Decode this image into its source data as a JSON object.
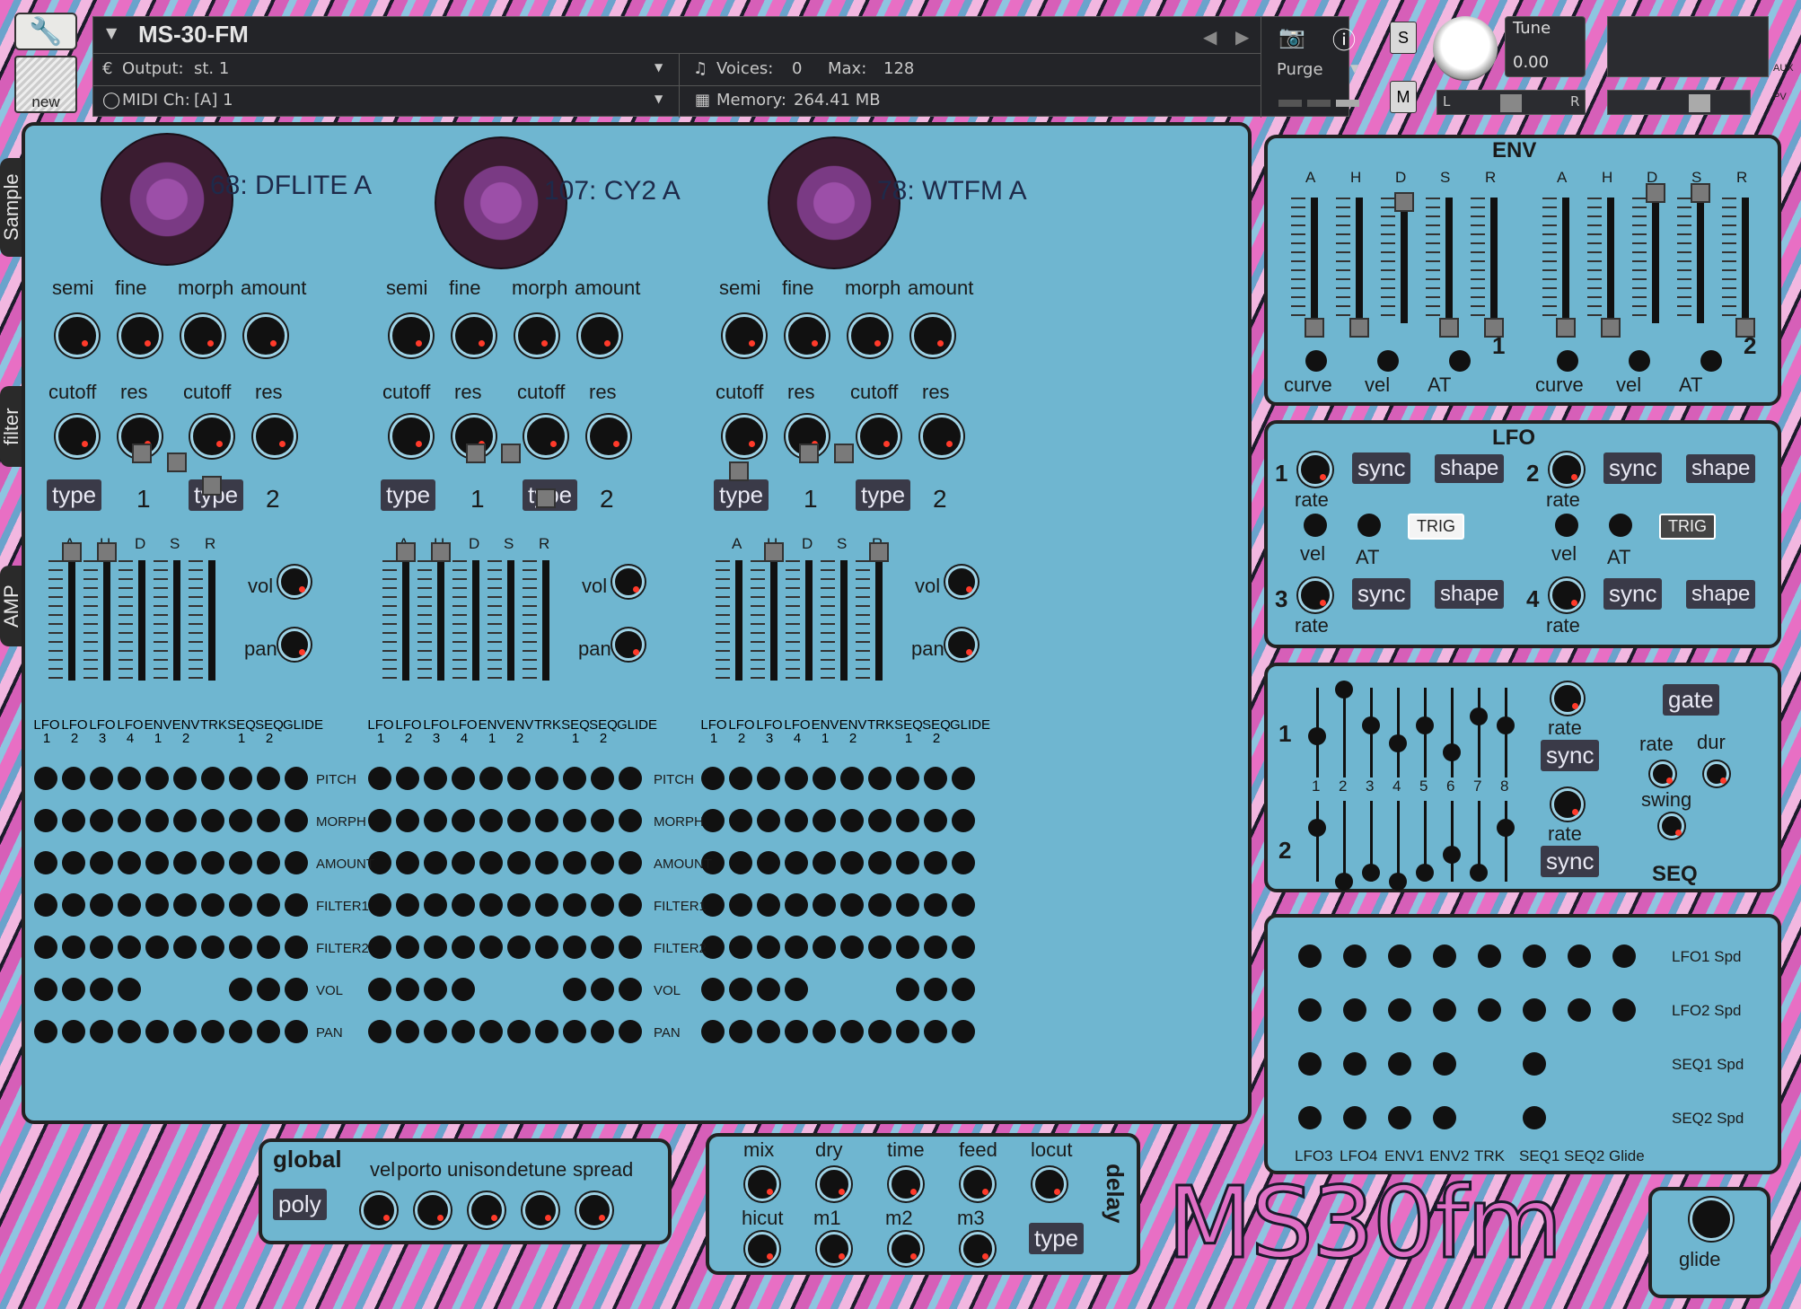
{
  "header": {
    "instrument_name": "MS-30-FM",
    "output_label": "Output:",
    "output_value": "st. 1",
    "midi_label": "MIDI Ch:",
    "midi_value": "[A] 1",
    "voices_label": "Voices:",
    "voices_value": "0",
    "max_label": "Max:",
    "max_value": "128",
    "memory_label": "Memory:",
    "memory_value": "264.41 MB",
    "purge_label": "Purge",
    "tune_label": "Tune",
    "tune_value": "0.00",
    "new_label": "new",
    "s_label": "S",
    "m_label": "M",
    "l_label": "L",
    "r_label": "R",
    "aux_label": "AUX",
    "pv_label": "PV"
  },
  "side_tabs": [
    "Sample",
    "filter",
    "AMP"
  ],
  "oscillators": [
    {
      "sample": "68: DFLITE A"
    },
    {
      "sample": "107: CY2 A"
    },
    {
      "sample": "78: WTFM A"
    }
  ],
  "osc_labels": {
    "semi": "semi",
    "fine": "fine",
    "morph": "morph",
    "amount": "amount",
    "cutoff": "cutoff",
    "res": "res",
    "type": "type",
    "one": "1",
    "two": "2",
    "vol": "vol",
    "pan": "pan"
  },
  "ahdsr": [
    "A",
    "H",
    "D",
    "S",
    "R"
  ],
  "mod_cols": [
    [
      "LFO",
      "1"
    ],
    [
      "LFO",
      "2"
    ],
    [
      "LFO",
      "3"
    ],
    [
      "LFO",
      "4"
    ],
    [
      "ENV",
      "1"
    ],
    [
      "ENV",
      "2"
    ],
    [
      "TRK",
      ""
    ],
    [
      "SEQ",
      "1"
    ],
    [
      "SEQ",
      "2"
    ],
    [
      "GLIDE",
      ""
    ]
  ],
  "mod_rows": [
    "PITCH",
    "MORPH",
    "AMOUNT",
    "FILTER1",
    "FILTER2",
    "VOL",
    "PAN"
  ],
  "env": {
    "title": "ENV",
    "labels": [
      "A",
      "H",
      "D",
      "S",
      "R"
    ],
    "num1": "1",
    "num2": "2",
    "curve": "curve",
    "vel": "vel",
    "at": "AT"
  },
  "lfo": {
    "title": "LFO",
    "rate": "rate",
    "sync": "sync",
    "shape": "shape",
    "vel": "vel",
    "at": "AT",
    "trig": "TRIG",
    "n1": "1",
    "n2": "2",
    "n3": "3",
    "n4": "4"
  },
  "seq": {
    "title": "SEQ",
    "gate": "gate",
    "rate": "rate",
    "dur": "dur",
    "swing": "swing",
    "sync": "sync",
    "row1": "1",
    "row2": "2",
    "steps": [
      "1",
      "2",
      "3",
      "4",
      "5",
      "6",
      "7",
      "8"
    ]
  },
  "spd": {
    "rows": [
      "LFO1 Spd",
      "LFO2 Spd",
      "SEQ1 Spd",
      "SEQ2 Spd"
    ],
    "cols": [
      "LFO3",
      "LFO4",
      "ENV1",
      "ENV2",
      "TRK",
      "SEQ1",
      "SEQ2",
      "Glide"
    ]
  },
  "global": {
    "title": "global",
    "poly": "poly",
    "vel": "vel",
    "porto": "porto",
    "unison": "unison",
    "detune": "detune",
    "spread": "spread"
  },
  "delay": {
    "title": "delay",
    "mix": "mix",
    "dry": "dry",
    "time": "time",
    "feed": "feed",
    "locut": "locut",
    "hicut": "hicut",
    "m1": "m1",
    "m2": "m2",
    "m3": "m3",
    "type": "type"
  },
  "logo": "MS30fm",
  "glide_label": "glide",
  "colors": {
    "panel": "#6fb6d0",
    "accent_pink": "#e06fc5",
    "knob_dot": "#ff3a2a"
  }
}
